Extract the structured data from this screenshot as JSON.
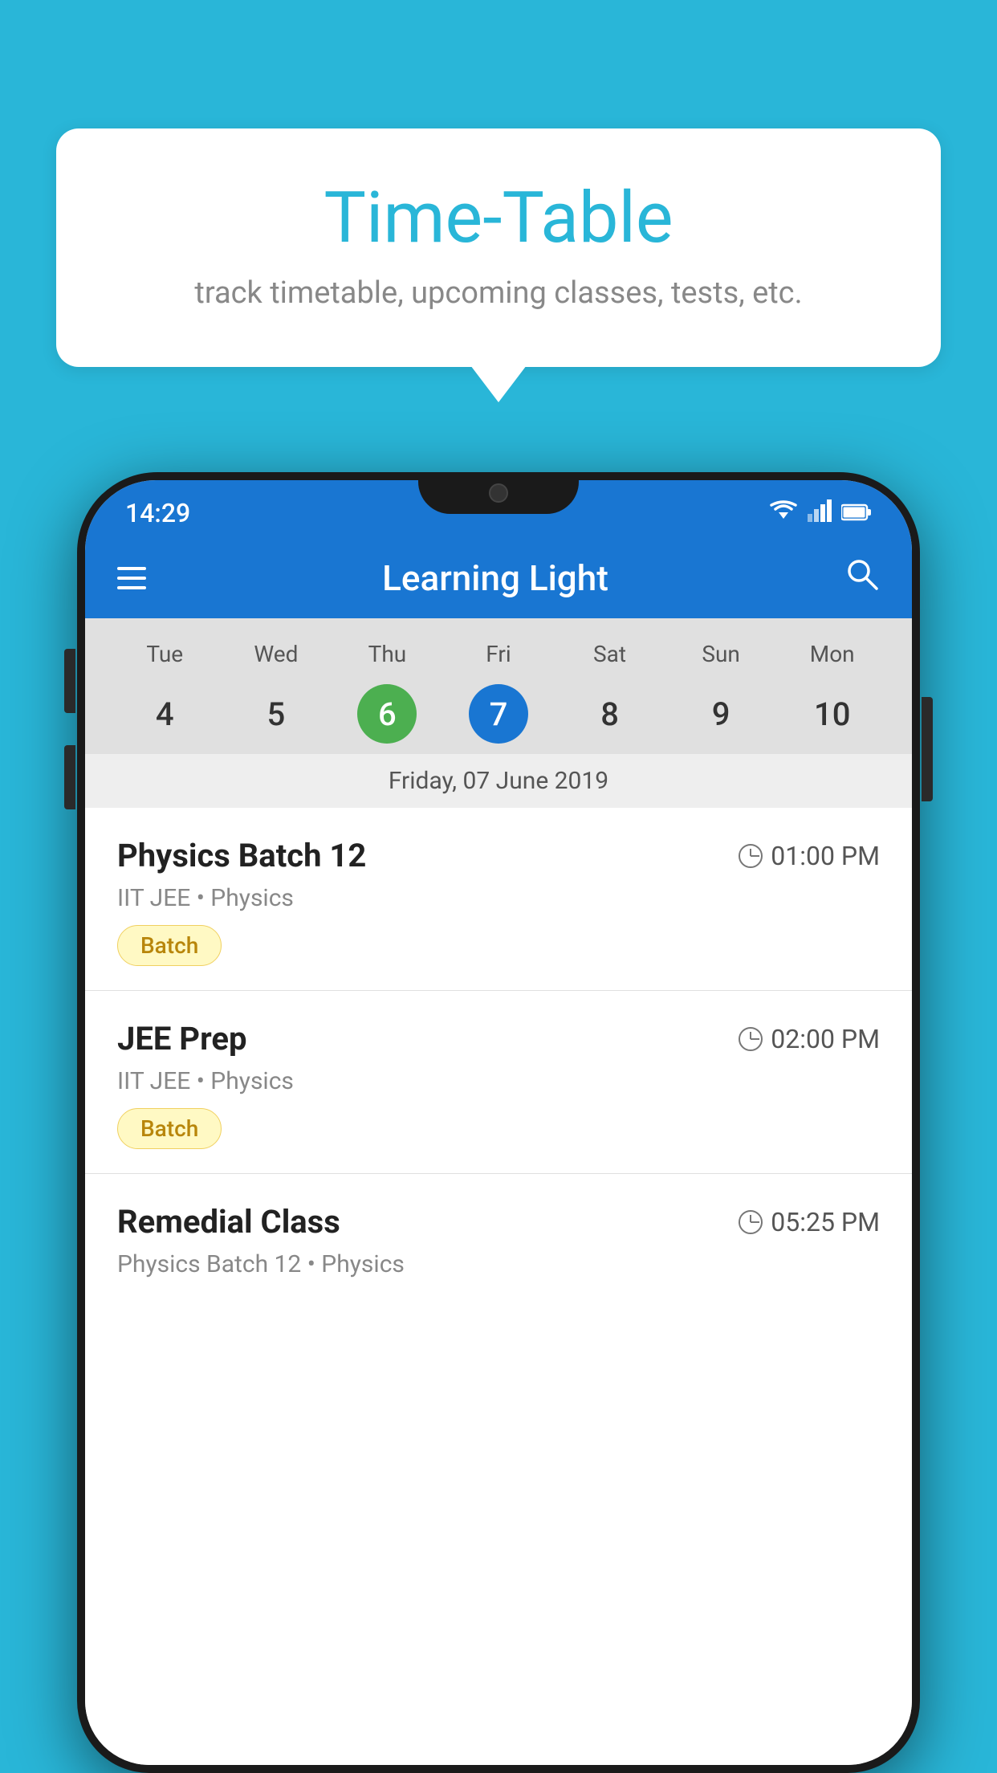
{
  "background_color": "#29B6D8",
  "tooltip": {
    "title": "Time-Table",
    "subtitle": "track timetable, upcoming classes, tests, etc."
  },
  "status_bar": {
    "time": "14:29"
  },
  "app_bar": {
    "title": "Learning Light"
  },
  "calendar": {
    "days": [
      "Tue",
      "Wed",
      "Thu",
      "Fri",
      "Sat",
      "Sun",
      "Mon"
    ],
    "dates": [
      "4",
      "5",
      "6",
      "7",
      "8",
      "9",
      "10"
    ],
    "today_index": 2,
    "selected_index": 3,
    "date_label": "Friday, 07 June 2019"
  },
  "schedule": [
    {
      "title": "Physics Batch 12",
      "time": "01:00 PM",
      "sub": "IIT JEE • Physics",
      "tag": "Batch"
    },
    {
      "title": "JEE Prep",
      "time": "02:00 PM",
      "sub": "IIT JEE • Physics",
      "tag": "Batch"
    },
    {
      "title": "Remedial Class",
      "time": "05:25 PM",
      "sub": "Physics Batch 12 • Physics",
      "tag": null
    }
  ]
}
